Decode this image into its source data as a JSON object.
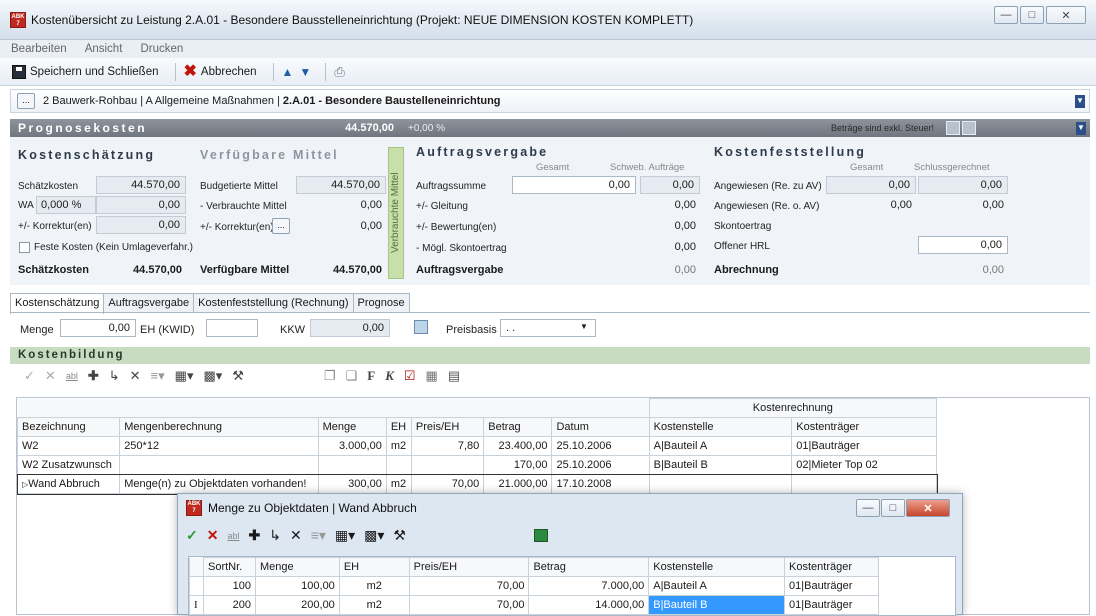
{
  "window": {
    "title": "Kostenübersicht zu Leistung 2.A.01 - Besondere Bausstelleneinrichtung  (Projekt: NEUE DIMENSION KOSTEN KOMPLETT)",
    "icon": "ABK 7"
  },
  "menu": [
    "Bearbeiten",
    "Ansicht",
    "Drucken"
  ],
  "toolbar": {
    "save_label": "Speichern und Schließen",
    "cancel_label": "Abbrechen"
  },
  "breadcrumb": {
    "path": "2 Bauwerk-Rohbau | A Allgemeine Maßnahmen | ",
    "current": "2.A.01 - Besondere Baustelleneinrichtung"
  },
  "prognose": {
    "title": "Prognosekosten",
    "value": "44.570,00",
    "pct": "+0,00 %",
    "note": "Beträge sind exkl. Steuer!"
  },
  "schaetzung": {
    "title": "Kostenschätzung",
    "schaetzkosten_label": "Schätzkosten",
    "schaetzkosten": "44.570,00",
    "wa_label": "WA",
    "wa_pct": "0,000 %",
    "wa_val": "0,00",
    "korr_label": "+/- Korrektur(en)",
    "korr_val": "0,00",
    "feste_label": "Feste Kosten (Kein Umlageverfahr.)",
    "total_label": "Schätzkosten",
    "total": "44.570,00"
  },
  "mittel": {
    "title": "Verfügbare Mittel",
    "budget_label": "Budgetierte Mittel",
    "budget": "44.570,00",
    "verbraucht_label": "- Verbrauchte Mittel",
    "verbraucht": "0,00",
    "korr_label": "+/- Korrektur(en)",
    "korr": "0,00",
    "total_label": "Verfügbare Mittel",
    "total": "44.570,00",
    "side_label": "Verbrauchte Mittel"
  },
  "vergabe": {
    "title": "Auftragsvergabe",
    "col1": "Gesamt",
    "col2": "Schweb. Aufträge",
    "rows": [
      {
        "label": "Auftragssumme",
        "gesamt": "0,00",
        "schweb": "0,00"
      },
      {
        "label": "+/- Gleitung",
        "schweb": "0,00"
      },
      {
        "label": "+/- Bewertung(en)",
        "schweb": "0,00"
      },
      {
        "label": "- Mögl. Skontoertrag",
        "schweb": "0,00"
      }
    ],
    "total_label": "Auftragsvergabe",
    "total": "0,00"
  },
  "feststellung": {
    "title": "Kostenfeststellung",
    "col1": "Gesamt",
    "col2": "Schlussgerechnet",
    "rows": [
      {
        "label": "Angewiesen (Re. zu AV)",
        "gesamt": "0,00",
        "schluss": "0,00"
      },
      {
        "label": "Angewiesen (Re. o. AV)",
        "gesamt": "0,00",
        "schluss": "0,00"
      },
      {
        "label": "Skontoertrag"
      },
      {
        "label": "Offener HRL",
        "schluss": "0,00"
      }
    ],
    "total_label": "Abrechnung",
    "total": "0,00"
  },
  "tabs": [
    "Kostenschätzung",
    "Auftragsvergabe",
    "Kostenfeststellung (Rechnung)",
    "Prognose"
  ],
  "menge": {
    "menge_label": "Menge",
    "menge": "0,00",
    "eh_label": "EH (KWID)",
    "kkw_label": "KKW",
    "kkw": "0,00",
    "preisbasis_label": "Preisbasis",
    "preisbasis": ". ."
  },
  "kostenbildung": {
    "title": "Kostenbildung"
  },
  "grid": {
    "group": "Kostenrechnung",
    "headers": [
      "Bezeichnung",
      "Mengenberechnung",
      "Menge",
      "EH",
      "Preis/EH",
      "Betrag",
      "Datum",
      "Kostenstelle",
      "Kostenträger"
    ],
    "rows": [
      [
        "W2",
        "250*12",
        "3.000,00",
        "m2",
        "7,80",
        "23.400,00",
        "25.10.2006",
        "A|Bauteil A",
        "01|Bauträger"
      ],
      [
        "W2 Zusatzwunsch",
        "",
        "",
        "",
        "",
        "170,00",
        "25.10.2006",
        "B|Bauteil B",
        "02|Mieter Top 02"
      ],
      [
        "Wand Abbruch",
        "Menge(n) zu Objektdaten vorhanden!",
        "300,00",
        "m2",
        "70,00",
        "21.000,00",
        "17.10.2008",
        "",
        ""
      ]
    ]
  },
  "dialog": {
    "title": "Menge zu Objektdaten | Wand Abbruch",
    "headers": [
      "SortNr.",
      "Menge",
      "EH",
      "Preis/EH",
      "Betrag",
      "Kostenstelle",
      "Kostenträger"
    ],
    "rows": [
      [
        "100",
        "100,00",
        "m2",
        "70,00",
        "7.000,00",
        "A|Bauteil A",
        "01|Bauträger"
      ],
      [
        "200",
        "200,00",
        "m2",
        "70,00",
        "14.000,00",
        "B|Bauteil B",
        "01|Bauträger"
      ]
    ]
  }
}
